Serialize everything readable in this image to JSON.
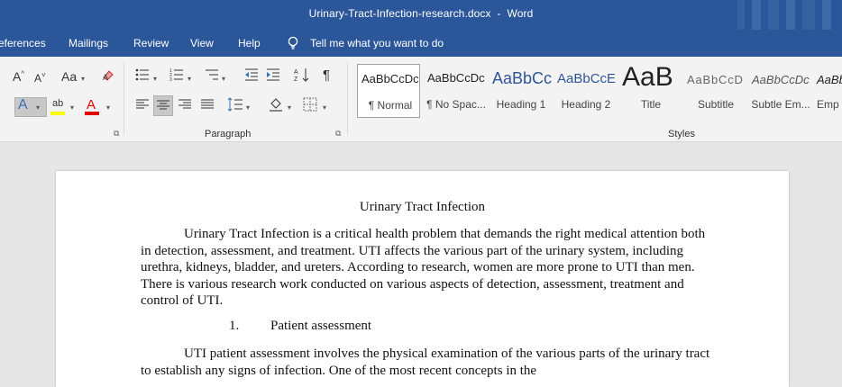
{
  "window": {
    "filename": "Urinary-Tract-Infection-research.docx",
    "separator": "-",
    "app": "Word"
  },
  "tabs": [
    "eferences",
    "Mailings",
    "Review",
    "View",
    "Help"
  ],
  "tell_me": "Tell me what you want to do",
  "ribbon": {
    "paragraph_label": "Paragraph",
    "styles_label": "Styles",
    "styles": [
      {
        "sample": "AaBbCcDc",
        "name": "¶ Normal"
      },
      {
        "sample": "AaBbCcDc",
        "name": "¶ No Spac..."
      },
      {
        "sample": "AaBbCc",
        "name": "Heading 1"
      },
      {
        "sample": "AaBbCcE",
        "name": "Heading 2"
      },
      {
        "sample": "AaB",
        "name": "Title"
      },
      {
        "sample": "AaBbCcD",
        "name": "Subtitle"
      },
      {
        "sample": "AaBbCcDc",
        "name": "Subtle Em..."
      },
      {
        "sample": "AaBb",
        "name": "Emp"
      }
    ],
    "colors": {
      "highlight": "#ffff00",
      "font_color": "#e00000",
      "accent": "#2b579a"
    }
  },
  "document": {
    "title": "Urinary Tract Infection",
    "paragraph1": "Urinary Tract Infection is a critical health problem that demands the right medical attention both in detection, assessment, and treatment. UTI affects the various part of the urinary system, including urethra, kidneys, bladder, and ureters. According to research, women are more prone to UTI than men. There is various research work conducted on various aspects of detection, assessment, treatment and control of UTI.",
    "heading_number": "1.",
    "heading_text": "Patient assessment",
    "paragraph2": "UTI patient assessment involves the physical examination of the various parts of the urinary tract to establish any signs of infection. One of the most recent concepts in the"
  }
}
